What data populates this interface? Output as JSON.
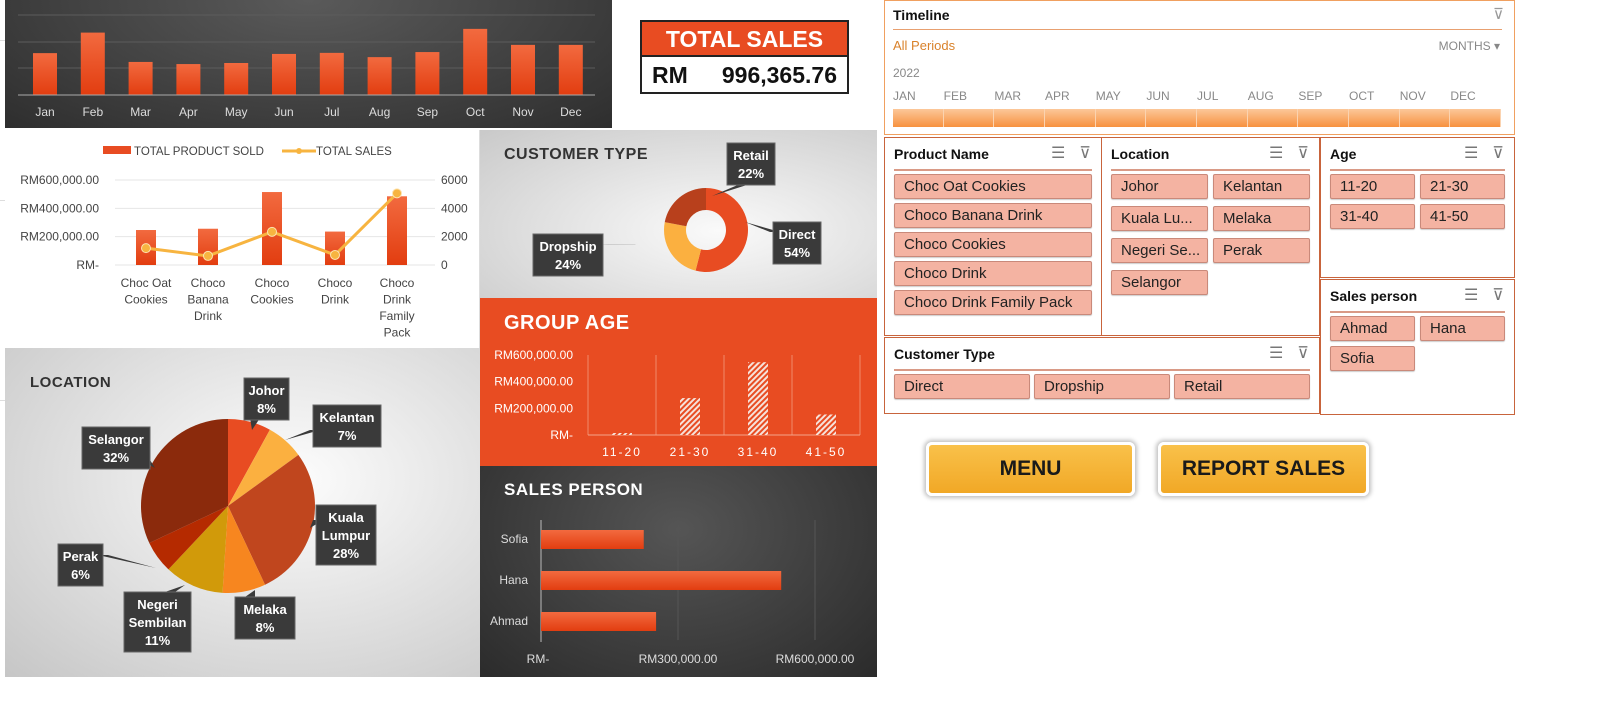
{
  "total_sales": {
    "title": "TOTAL SALES",
    "currency": "RM",
    "value": "996,365.76"
  },
  "panels": {
    "customer_type_title": "CUSTOMER TYPE",
    "group_age_title": "GROUP AGE",
    "sales_person_title": "SALES PERSON",
    "location_title": "LOCATION"
  },
  "timeline": {
    "title": "Timeline",
    "period": "All Periods",
    "level": "MONTHS",
    "year": "2022",
    "months": [
      "JAN",
      "FEB",
      "MAR",
      "APR",
      "MAY",
      "JUN",
      "JUL",
      "AUG",
      "SEP",
      "OCT",
      "NOV",
      "DEC"
    ],
    "selected_fraction": 1.0
  },
  "slicers": {
    "product": {
      "title": "Product Name",
      "items": [
        "Choc Oat Cookies",
        "Choco Banana Drink",
        "Choco Cookies",
        "Choco Drink",
        "Choco Drink Family Pack"
      ]
    },
    "location": {
      "title": "Location",
      "items": [
        "Johor",
        "Kelantan",
        "Kuala Lu...",
        "Melaka",
        "Negeri Se...",
        "Perak",
        "Selangor"
      ]
    },
    "age": {
      "title": "Age",
      "items": [
        "11-20",
        "21-30",
        "31-40",
        "41-50"
      ]
    },
    "sales_person": {
      "title": "Sales person",
      "items": [
        "Ahmad",
        "Hana",
        "Sofia"
      ]
    },
    "customer_type": {
      "title": "Customer Type",
      "items": [
        "Direct",
        "Dropship",
        "Retail"
      ]
    }
  },
  "buttons": {
    "menu": "MENU",
    "report": "REPORT SALES"
  },
  "colors": {
    "accent": "#e84c22",
    "slicer_item": "#f4b3a2",
    "button": "#f5b53a",
    "dark_panel": "#3a3a3a"
  },
  "chart_data": [
    {
      "id": "monthly",
      "type": "bar",
      "categories": [
        "Jan",
        "Feb",
        "Mar",
        "Apr",
        "May",
        "Jun",
        "Jul",
        "Aug",
        "Sep",
        "Oct",
        "Nov",
        "Dec"
      ],
      "values": [
        78500,
        117000,
        62000,
        58000,
        60000,
        77000,
        79000,
        71000,
        80500,
        124000,
        94000,
        94000
      ],
      "ylim": [
        0,
        150000
      ],
      "grid": true,
      "color": "#e84c22"
    },
    {
      "id": "product",
      "type": "bar+line",
      "categories": [
        "Choc Oat Cookies",
        "Choco Banana Drink",
        "Choco Cookies",
        "Choco Drink",
        "Choco Drink Family Pack"
      ],
      "category_lines": [
        [
          "Choc Oat",
          "Cookies"
        ],
        [
          "Choco",
          "Banana",
          "Drink"
        ],
        [
          "Choco",
          "Cookies"
        ],
        [
          "Choco",
          "Drink"
        ],
        [
          "Choco",
          "Drink",
          "Family",
          "Pack"
        ]
      ],
      "series": [
        {
          "name": "TOTAL PRODUCT SOLD",
          "type": "bar",
          "axis": "right",
          "values": [
            2470,
            2560,
            5150,
            2360,
            4850
          ],
          "color": "#e84c22"
        },
        {
          "name": "TOTAL SALES",
          "type": "line",
          "axis": "left",
          "values": [
            119000,
            64000,
            234000,
            71000,
            506000
          ],
          "color": "#f7b440"
        }
      ],
      "left_ticks": [
        "RM-",
        "RM200,000.00",
        "RM400,000.00",
        "RM600,000.00"
      ],
      "left_ylim": [
        0,
        600000
      ],
      "right_ticks": [
        "0",
        "2000",
        "4000",
        "6000"
      ],
      "right_ylim": [
        0,
        6000
      ],
      "legend": "top",
      "grid": true
    },
    {
      "id": "customer_type",
      "type": "donut",
      "title": "CUSTOMER TYPE",
      "slices": [
        {
          "label": "Direct",
          "pct": "54%",
          "value": 54,
          "color": "#e84c22"
        },
        {
          "label": "Dropship",
          "pct": "24%",
          "value": 24,
          "color": "#fbb040"
        },
        {
          "label": "Retail",
          "pct": "22%",
          "value": 22,
          "color": "#b8401c"
        }
      ]
    },
    {
      "id": "group_age",
      "type": "bar",
      "title": "GROUP AGE",
      "categories": [
        "11-20",
        "21-30",
        "31-40",
        "41-50"
      ],
      "values": [
        12000,
        277000,
        546000,
        154000
      ],
      "ylim": [
        0,
        600000
      ],
      "ticks": [
        "RM-",
        "RM200,000.00",
        "RM400,000.00",
        "RM600,000.00"
      ],
      "pattern": "hatched"
    },
    {
      "id": "sales_person",
      "type": "horizontal-bar",
      "title": "SALES PERSON",
      "categories": [
        "Sofia",
        "Hana",
        "Ahmad"
      ],
      "values": [
        225000,
        526000,
        252000
      ],
      "xlim": [
        0,
        600000
      ],
      "ticks": [
        "RM-",
        "RM300,000.00",
        "RM600,000.00"
      ],
      "color": "#e84c22"
    },
    {
      "id": "location",
      "type": "pie",
      "title": "LOCATION",
      "slices": [
        {
          "label": "Johor",
          "pct": "8%",
          "value": 8,
          "color": "#e84c22"
        },
        {
          "label": "Kelantan",
          "pct": "7%",
          "value": 7,
          "color": "#fbb040"
        },
        {
          "label": "Kuala Lumpur",
          "lines": [
            "Kuala",
            "Lumpur"
          ],
          "pct": "28%",
          "value": 28,
          "color": "#c0461e"
        },
        {
          "label": "Melaka",
          "pct": "8%",
          "value": 8,
          "color": "#f7861f"
        },
        {
          "label": "Negeri Sembilan",
          "lines": [
            "Negeri",
            "Sembilan"
          ],
          "pct": "11%",
          "value": 11,
          "color": "#d19a0a"
        },
        {
          "label": "Perak",
          "pct": "6%",
          "value": 6,
          "color": "#b52a00"
        },
        {
          "label": "Selangor",
          "pct": "32%",
          "value": 32,
          "color": "#8b2a0c"
        }
      ]
    }
  ]
}
